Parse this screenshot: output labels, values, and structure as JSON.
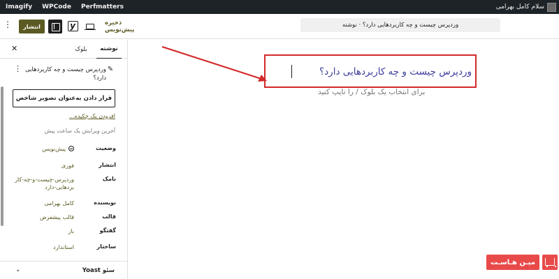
{
  "admin_bar": {
    "user_greeting": "سلام کامل بهرامی",
    "items": [
      "Imagify",
      "WPCode",
      "Perfmatters"
    ]
  },
  "header": {
    "publish_label": "انتشار",
    "save_draft_label": "ذخیره پیش‌نویس",
    "document_bar": "وردپرس چیست و چه کاربردهایی دارد؟ · نوشته",
    "icons": [
      "more-vertical-icon",
      "sidebar-toggle-icon",
      "yoast-icon",
      "preview-desktop-icon"
    ]
  },
  "sidebar": {
    "tabs": {
      "post": "نوشته",
      "block": "بلوک"
    },
    "summary_title": "وردپرس چیست و چه کاربردهایی دارد؟",
    "featured_image_button": "قرار دادن به‌عنوان تصویر شاخص",
    "excerpt_link": "افزودن یک چکیده...",
    "last_edited": "آخرین ویرایش یک ساعت پیش",
    "meta": [
      {
        "label": "وضعیت",
        "value": "پیش‌نویس"
      },
      {
        "label": "انتشار",
        "value": "فوری"
      },
      {
        "label": "نامک",
        "value": "وردپرس-چیست-و-چه-کاربردهایی-دارد"
      },
      {
        "label": "نویسنده",
        "value": "کامل بهرامی"
      },
      {
        "label": "قالب",
        "value": "قالب پیشفرض"
      },
      {
        "label": "گفتگو",
        "value": "باز"
      },
      {
        "label": "ساختار",
        "value": "استاندارد"
      }
    ],
    "yoast_panel": "سئو Yoast"
  },
  "canvas": {
    "post_title": "وردپرس چیست و چه کاربردهایی دارد؟",
    "block_placeholder": "برای انتخاب یک بلوک / را تایپ کنید"
  },
  "watermark": {
    "text": "میـن هـاسـت"
  },
  "colors": {
    "admin_bar_bg": "#1d2327",
    "accent_olive": "#5b5a22",
    "annotation_red": "#d42a2a",
    "title_blue": "#3d3d9c"
  }
}
